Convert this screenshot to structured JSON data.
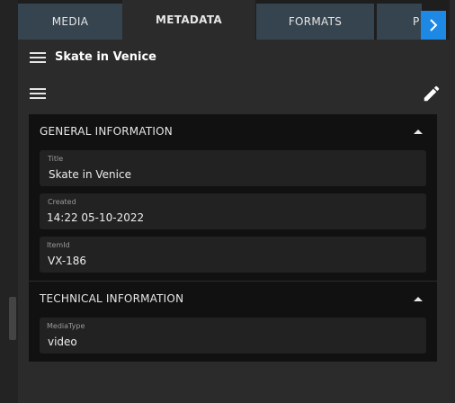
{
  "tabs": [
    {
      "label": "MEDIA"
    },
    {
      "label": "METADATA"
    },
    {
      "label": "FORMATS"
    },
    {
      "label": "P"
    }
  ],
  "header": {
    "title": "Skate in Venice"
  },
  "sections": [
    {
      "title": "GENERAL INFORMATION",
      "fields": [
        {
          "label": "Title",
          "value": "Skate in Venice"
        },
        {
          "label": "Created",
          "value": "14:22 05-10-2022"
        },
        {
          "label": "ItemId",
          "value": "VX-186"
        }
      ]
    },
    {
      "title": "TECHNICAL INFORMATION",
      "fields": [
        {
          "label": "MediaType",
          "value": "video"
        }
      ]
    }
  ],
  "colors": {
    "accent": "#1e88e5",
    "tab_bg": "#36444f",
    "card_bg": "#111111",
    "field_bg": "#222222"
  }
}
